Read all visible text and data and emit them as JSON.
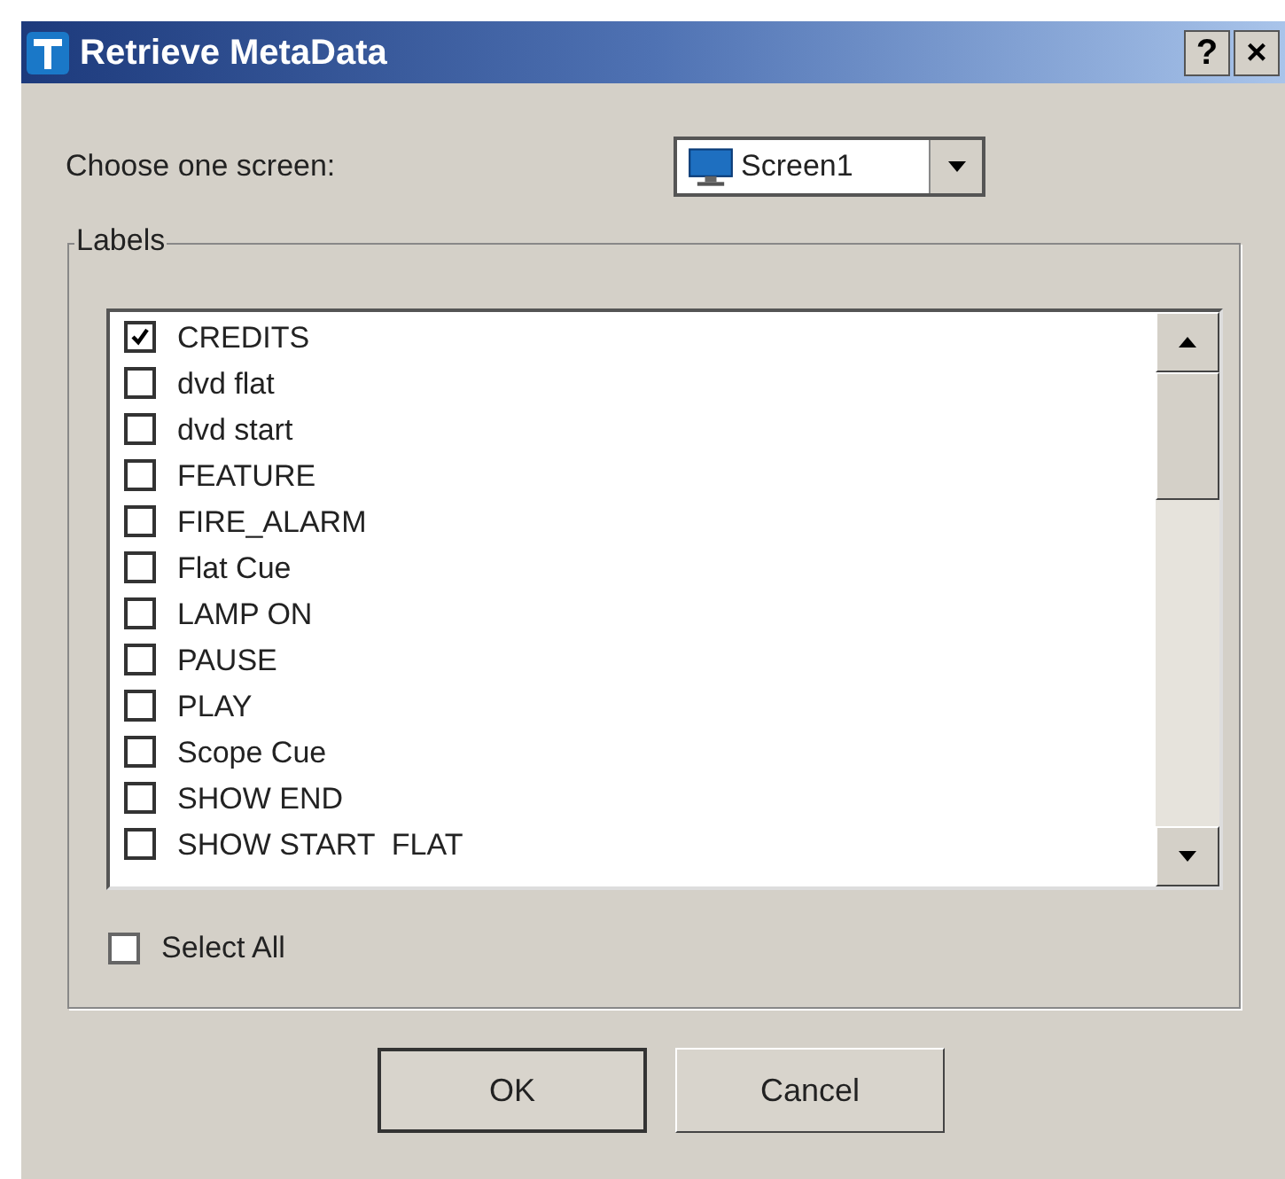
{
  "window": {
    "title": "Retrieve MetaData",
    "title_buttons": [
      "?",
      "×"
    ]
  },
  "screen_chooser": {
    "label": "Choose one screen:",
    "value": "Screen1"
  },
  "labels_group": {
    "title": "Labels",
    "items": [
      {
        "label": "CREDITS",
        "checked": true
      },
      {
        "label": "dvd flat",
        "checked": false
      },
      {
        "label": "dvd start",
        "checked": false
      },
      {
        "label": "FEATURE",
        "checked": false
      },
      {
        "label": "FIRE_ALARM",
        "checked": false
      },
      {
        "label": "Flat Cue",
        "checked": false
      },
      {
        "label": "LAMP ON",
        "checked": false
      },
      {
        "label": "PAUSE",
        "checked": false
      },
      {
        "label": "PLAY",
        "checked": false
      },
      {
        "label": "Scope Cue",
        "checked": false
      },
      {
        "label": "SHOW END",
        "checked": false
      },
      {
        "label": "SHOW START  FLAT",
        "checked": false
      }
    ],
    "select_all": {
      "label": "Select All",
      "checked": false
    }
  },
  "buttons": [
    "OK",
    "Cancel"
  ]
}
